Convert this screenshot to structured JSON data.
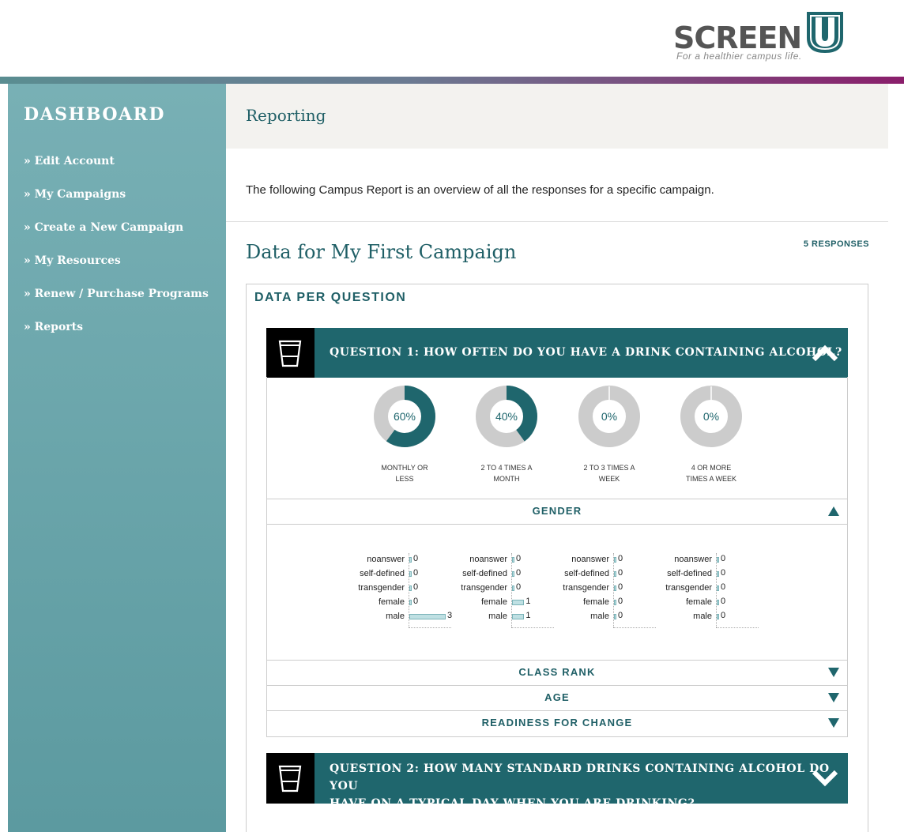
{
  "brand": {
    "name": "SCREEN",
    "letter": "U",
    "tagline": "For a healthier campus life."
  },
  "sidebar": {
    "title": "DASHBOARD",
    "items": [
      {
        "label": "» Edit Account"
      },
      {
        "label": "» My Campaigns"
      },
      {
        "label": "» Create a New Campaign"
      },
      {
        "label": "» My Resources"
      },
      {
        "label": "» Renew / Purchase Programs"
      },
      {
        "label": "» Reports"
      }
    ]
  },
  "main": {
    "page_title": "Reporting",
    "intro": "The following Campus Report is an overview of all the responses for a specific campaign.",
    "data_title": "Data for My First Campaign",
    "responses": "5 RESPONSES",
    "section_title": "DATA PER QUESTION"
  },
  "questions": [
    {
      "text": "QUESTION 1: HOW OFTEN DO YOU HAVE A DRINK CONTAINING ALCOHOL?",
      "icon": "cup-icon",
      "expanded": true,
      "answers": [
        {
          "percent": "60%",
          "value": 60,
          "label_line1": "MONTHLY OR",
          "label_line2": "LESS"
        },
        {
          "percent": "40%",
          "value": 40,
          "label_line1": "2 TO 4 TIMES A",
          "label_line2": "MONTH"
        },
        {
          "percent": "0%",
          "value": 0,
          "label_line1": "2 TO 3 TIMES A",
          "label_line2": "WEEK"
        },
        {
          "percent": "0%",
          "value": 0,
          "label_line1": "4 OR MORE",
          "label_line2": "TIMES A WEEK"
        }
      ],
      "breakdowns": [
        {
          "label": "GENDER",
          "expanded": true
        },
        {
          "label": "CLASS RANK",
          "expanded": false
        },
        {
          "label": "AGE",
          "expanded": false
        },
        {
          "label": "READINESS FOR CHANGE",
          "expanded": false
        }
      ],
      "gender_categories": [
        "noanswer",
        "self-defined",
        "transgender",
        "female",
        "male"
      ],
      "gender_values": [
        [
          "0",
          "0",
          "0",
          "0",
          "3"
        ],
        [
          "0",
          "0",
          "0",
          "1",
          "1"
        ],
        [
          "0",
          "0",
          "0",
          "0",
          "0"
        ],
        [
          "0",
          "0",
          "0",
          "0",
          "0"
        ]
      ]
    },
    {
      "text_line1": "QUESTION 2: HOW MANY STANDARD DRINKS CONTAINING ALCOHOL DO YOU",
      "text_line2": "HAVE ON A TYPICAL DAY WHEN YOU ARE DRINKING?",
      "icon": "cup-icon",
      "expanded": false
    }
  ],
  "colors": {
    "teal": "#1f666d",
    "accent": "#1f5f66",
    "donut_empty": "#cccccc",
    "sidebar": "#6aa6ab"
  }
}
